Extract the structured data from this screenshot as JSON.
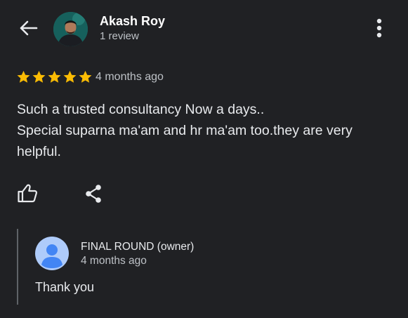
{
  "header": {
    "back_icon": "arrow-left-icon",
    "reviewer_name": "Akash Roy",
    "review_count": "1 review",
    "more_icon": "more-vert-icon"
  },
  "review": {
    "rating": 5,
    "max_rating": 5,
    "star_color": "#fbbc04",
    "time": "4 months ago",
    "text_lines": [
      "Such a trusted consultancy Now a days..",
      "Special suparna ma'am and hr ma'am too.they are very",
      "helpful."
    ]
  },
  "actions": {
    "like_icon": "thumb-up-icon",
    "share_icon": "share-icon"
  },
  "owner_response": {
    "name": "FINAL ROUND (owner)",
    "time": "4 months ago",
    "text": "Thank you",
    "avatar_color": "#aecbfa",
    "avatar_figure_color": "#4285f4"
  }
}
